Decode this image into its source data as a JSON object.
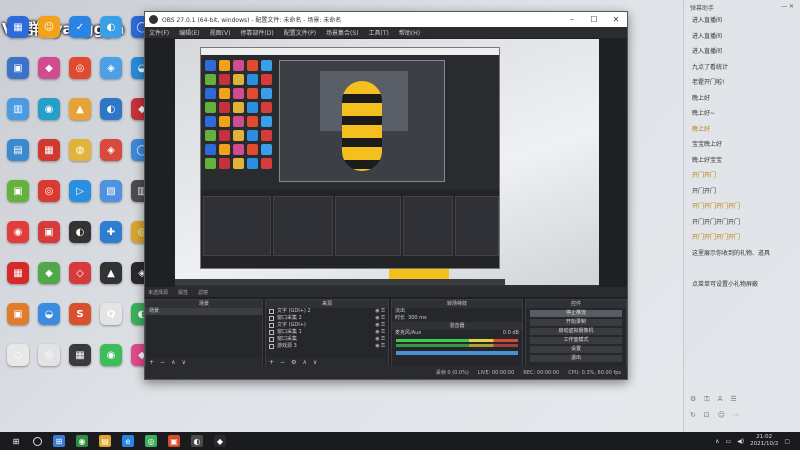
{
  "watermark": "VX群+yaoggya",
  "desktop_icons": [
    {
      "label": "",
      "color": "#2e6bd8",
      "glyph": "▦"
    },
    {
      "label": "",
      "color": "#f0a21a",
      "glyph": "☺"
    },
    {
      "label": "",
      "color": "#2a84e6",
      "glyph": "✓"
    },
    {
      "label": "",
      "color": "#3a9ee8",
      "glyph": "◐"
    },
    {
      "label": "",
      "color": "#2e6bd8",
      "glyph": "◯"
    },
    {
      "label": "",
      "color": "#3a73c9",
      "glyph": "▣"
    },
    {
      "label": "",
      "color": "#d14b8f",
      "glyph": "◆"
    },
    {
      "label": "",
      "color": "#e04a2f",
      "glyph": "◎"
    },
    {
      "label": "",
      "color": "#4da0e6",
      "glyph": "◈"
    },
    {
      "label": "",
      "color": "#2b8bd6",
      "glyph": "◒"
    },
    {
      "label": "",
      "color": "#4a9be2",
      "glyph": "▥"
    },
    {
      "label": "",
      "color": "#24a0c8",
      "glyph": "◉"
    },
    {
      "label": "",
      "color": "#e8a235",
      "glyph": "▲"
    },
    {
      "label": "",
      "color": "#2f77c6",
      "glyph": "◐"
    },
    {
      "label": "",
      "color": "#c7323a",
      "glyph": "◆"
    },
    {
      "label": "",
      "color": "#3b8ad0",
      "glyph": "▤"
    },
    {
      "label": "",
      "color": "#d0392f",
      "glyph": "▦"
    },
    {
      "label": "",
      "color": "#e0b43b",
      "glyph": "◍"
    },
    {
      "label": "",
      "color": "#d84a3b",
      "glyph": "◈"
    },
    {
      "label": "",
      "color": "#3d89db",
      "glyph": "◯"
    },
    {
      "label": "",
      "color": "#64b13b",
      "glyph": "▣"
    },
    {
      "label": "",
      "color": "#d93b32",
      "glyph": "◎"
    },
    {
      "label": "",
      "color": "#2b8fe0",
      "glyph": "▷"
    },
    {
      "label": "",
      "color": "#4e92e0",
      "glyph": "▧"
    },
    {
      "label": "",
      "color": "#4d4d4d",
      "glyph": "▥"
    },
    {
      "label": "",
      "color": "#e33c3c",
      "glyph": "◉"
    },
    {
      "label": "",
      "color": "#d63b3b",
      "glyph": "▣"
    },
    {
      "label": "",
      "color": "#333333",
      "glyph": "◐"
    },
    {
      "label": "",
      "color": "#2f7dd1",
      "glyph": "✚"
    },
    {
      "label": "",
      "color": "#d9a52c",
      "glyph": "◎"
    },
    {
      "label": "",
      "color": "#d62a2a",
      "glyph": "▦"
    },
    {
      "label": "",
      "color": "#51a84c",
      "glyph": "◆"
    },
    {
      "label": "",
      "color": "#d63b3b",
      "glyph": "◇"
    },
    {
      "label": "",
      "color": "#333333",
      "glyph": "▲"
    },
    {
      "label": "",
      "color": "#2a2a2a",
      "glyph": "◈"
    },
    {
      "label": "",
      "color": "#e07d2a",
      "glyph": "▣"
    },
    {
      "label": "",
      "color": "#3c8be0",
      "glyph": "◒"
    },
    {
      "label": "",
      "color": "#d9502f",
      "glyph": "S"
    },
    {
      "label": "",
      "color": "#e4e4e4",
      "glyph": "Q"
    },
    {
      "label": "",
      "color": "#3bb05a",
      "glyph": "◐"
    },
    {
      "label": "",
      "color": "#e8e8e8",
      "glyph": "◇"
    },
    {
      "label": "",
      "color": "#e3e3e3",
      "glyph": "◎"
    },
    {
      "label": "",
      "color": "#3a3a3a",
      "glyph": "▦"
    },
    {
      "label": "",
      "color": "#3dbd5a",
      "glyph": "◉"
    },
    {
      "label": "",
      "color": "#e04a8c",
      "glyph": "◆"
    }
  ],
  "obs": {
    "title": "OBS 27.0.1 (64-bit, windows) - 配置文件: 未命名 - 场景: 未命名",
    "menu": [
      "文件(F)",
      "编辑(E)",
      "视图(V)",
      "停靠部件(D)",
      "配置文件(P)",
      "场景集合(S)",
      "工具(T)",
      "帮助(H)"
    ],
    "dock_tabs": [
      "未选择源",
      "属性",
      "滤镜"
    ],
    "scenes_header": "场景",
    "scenes": [
      "场景"
    ],
    "sources_header": "来源",
    "sources": [
      "文字 (GDI+) 2",
      "窗口采集 2",
      "文字 (GDI+)",
      "窗口采集 1",
      "窗口采集",
      "游戏源 3"
    ],
    "transition_header": "转场特效",
    "transition_value": "淡出",
    "duration_label": "时长",
    "duration_value": "300 ms",
    "mixer_header": "混音器",
    "mixer_label": "麦克风/Aux",
    "mixer_db": "0.0 dB",
    "controls_header": "控件",
    "controls": [
      "停止推流",
      "开始录制",
      "启动虚拟摄像机",
      "工作室模式",
      "设置",
      "退出"
    ],
    "status": [
      "丢帧 0 (0.0%)",
      "LIVE: 00:00:00",
      "REC: 00:00:00",
      "CPU: 0.3%, 60.00 fps"
    ]
  },
  "chat": {
    "header_left": "弹幕助手",
    "lines": [
      {
        "nick": "",
        "msg": "进入直播间",
        "hl": false,
        "y": false
      },
      {
        "nick": "",
        "msg": "进入直播间",
        "hl": false,
        "y": false
      },
      {
        "nick": "",
        "msg": "进入直播间",
        "hl": false,
        "y": false
      },
      {
        "nick": "",
        "msg": "九点了看统计",
        "hl": false,
        "y": false
      },
      {
        "nick": "",
        "msg": "老霍开门啦!",
        "hl": false,
        "y": false
      },
      {
        "nick": "",
        "msg": "晚上好",
        "hl": true,
        "y": false
      },
      {
        "nick": "",
        "msg": "晚上好~",
        "hl": false,
        "y": false
      },
      {
        "nick": "",
        "msg": "晚上好",
        "hl": false,
        "y": true
      },
      {
        "nick": "",
        "msg": "宝宝晚上好",
        "hl": false,
        "y": false
      },
      {
        "nick": "",
        "msg": "晚上好宝宝",
        "hl": true,
        "y": false
      },
      {
        "nick": "",
        "msg": "开门开门",
        "hl": false,
        "y": true
      },
      {
        "nick": "",
        "msg": "开门开门",
        "hl": false,
        "y": false
      },
      {
        "nick": "",
        "msg": "开门开门开门开门",
        "hl": false,
        "y": true
      },
      {
        "nick": "",
        "msg": "开门开门开门开门",
        "hl": false,
        "y": false
      },
      {
        "nick": "",
        "msg": "开门开门开门开门",
        "hl": false,
        "y": true
      },
      {
        "nick": "",
        "msg": "这里展示你收到的礼物、道具",
        "hl": false,
        "y": false
      },
      {
        "nick": "",
        "msg": "",
        "hl": false,
        "y": false
      },
      {
        "nick": "",
        "msg": "点菜单可设置小礼物屏蔽",
        "hl": false,
        "y": false
      }
    ]
  },
  "taskbar": {
    "items": [
      {
        "color": "#3a7bd5",
        "glyph": "⊞"
      },
      {
        "color": "#2f8f3f",
        "glyph": "◉"
      },
      {
        "color": "#e0a52c",
        "glyph": "▤"
      },
      {
        "color": "#2a84e6",
        "glyph": "e"
      },
      {
        "color": "#3bb05a",
        "glyph": "◎"
      },
      {
        "color": "#d94a2a",
        "glyph": "▣"
      },
      {
        "color": "#4a4a4a",
        "glyph": "◐"
      },
      {
        "color": "#2b2b2b",
        "glyph": "◆"
      }
    ],
    "time": "21:02",
    "date": "2021/10/2"
  }
}
